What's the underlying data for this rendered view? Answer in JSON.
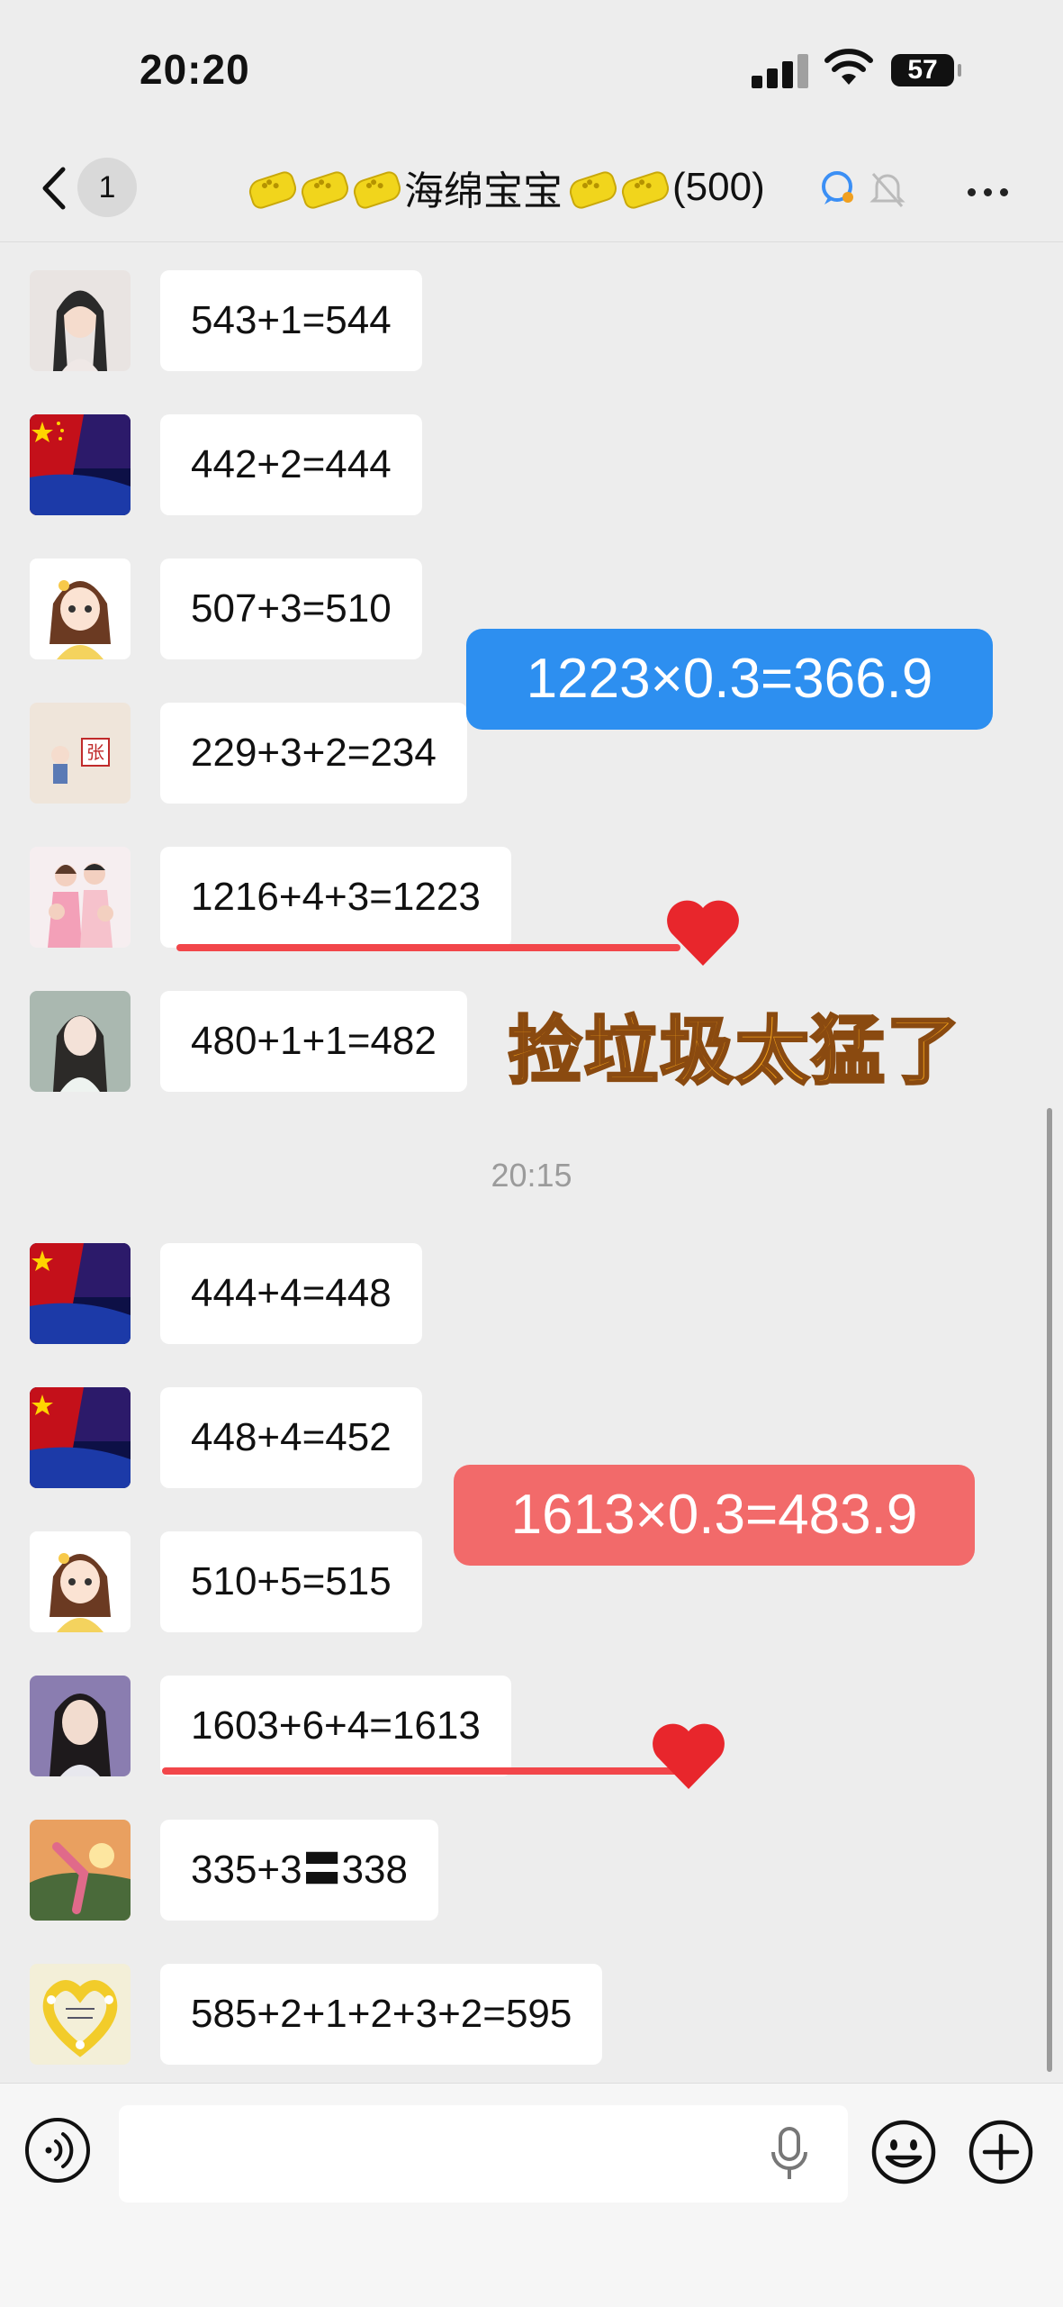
{
  "status_bar": {
    "time": "20:20",
    "battery": "57"
  },
  "nav": {
    "back_count": "1",
    "title_text": "海绵宝宝",
    "member_count": "(500)"
  },
  "messages": [
    {
      "text": "543+1=544",
      "avatar": "woman-portrait-avatar"
    },
    {
      "text": "442+2=444",
      "avatar": "flag-landscape-avatar"
    },
    {
      "text": "507+3=510",
      "avatar": "cartoon-girl-avatar"
    },
    {
      "text": "229+3+2=234",
      "avatar": "zhang-badge-avatar"
    },
    {
      "text": "1216+4+3=1223",
      "avatar": "family-photo-avatar"
    },
    {
      "text": "480+1+1=482",
      "avatar": "woman-portrait-avatar"
    },
    {
      "text": "444+4=448",
      "avatar": "flag-landscape-avatar"
    },
    {
      "text": "448+4=452",
      "avatar": "flag-landscape-avatar"
    },
    {
      "text": "510+5=515",
      "avatar": "cartoon-girl-avatar"
    },
    {
      "text": "1603+6+4=1613",
      "avatar": "woman-selfie-avatar"
    },
    {
      "text": "335+3〓338",
      "avatar": "sunset-pose-avatar"
    },
    {
      "text": "585+2+1+2+3+2=595",
      "avatar": "flower-wreath-avatar"
    }
  ],
  "timestamp": "20:15",
  "overlays": {
    "blue_calc": "1223×0.3=366.9",
    "red_calc": "1613×0.3=483.9",
    "caption": "捡垃圾太猛了",
    "colors": {
      "blue": "#2d8ff0",
      "red": "#f26a6a",
      "caption": "#f5a31a",
      "underline": "#f2464a"
    }
  },
  "input": {
    "placeholder": ""
  }
}
